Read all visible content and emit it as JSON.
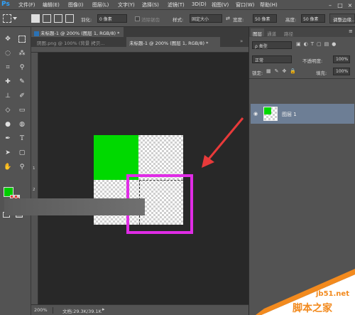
{
  "menubar": {
    "logo": "Ps",
    "items": [
      "文件(F)",
      "编辑(E)",
      "图像(I)",
      "图层(L)",
      "文字(Y)",
      "选择(S)",
      "滤镜(T)",
      "3D(D)",
      "视图(V)",
      "窗口(W)",
      "帮助(H)"
    ],
    "controls": [
      "–",
      "□",
      "×"
    ]
  },
  "options": {
    "feather_label": "羽化:",
    "feather_value": "0 像素",
    "antialias_label": "消除锯齿",
    "style_label": "样式:",
    "style_value": "固定大小",
    "width_label": "宽度:",
    "width_value": "50 像素",
    "height_label": "高度:",
    "height_value": "50 像素",
    "refine_edge": "调整边缘..."
  },
  "tabs": [
    {
      "label": "未标题-1 @ 200% (图层 1, RGB/8) *",
      "active": true
    },
    {
      "label": "阴图.png @ 100% (背景 拷贝...",
      "active": false
    },
    {
      "label": "未标题-1 @ 200% (图层 1, RGB/8) *",
      "active": false
    }
  ],
  "ruler_left": [
    "1",
    "2",
    "3"
  ],
  "status": {
    "zoom": "200%",
    "doc": "文档:29.3K/39.1K"
  },
  "layers_panel": {
    "tabs": [
      "图层",
      "通道",
      "路径"
    ],
    "kind_label": "ρ 类型",
    "blend_mode": "正常",
    "opacity_label": "不透明度:",
    "opacity_value": "100%",
    "lock_label": "锁定:",
    "fill_label": "填充:",
    "fill_value": "100%",
    "layer_name": "图层 1"
  },
  "colors": {
    "foreground": "#00cc00",
    "background": "#e23a3a",
    "green_block": "#00d900",
    "highlight_box": "#e02ce6",
    "arrow": "#e83a3a"
  },
  "watermark": {
    "site": "jb51.net",
    "brand": "脚本之家"
  }
}
